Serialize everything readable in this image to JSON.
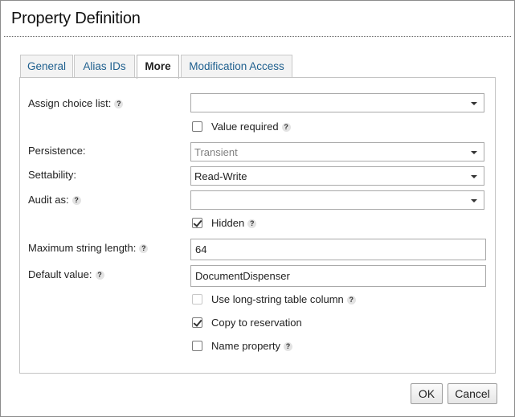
{
  "dialog": {
    "title": "Property Definition"
  },
  "tabs": [
    {
      "label": "General",
      "active": false
    },
    {
      "label": "Alias IDs",
      "active": false
    },
    {
      "label": "More",
      "active": true
    },
    {
      "label": "Modification Access",
      "active": false
    }
  ],
  "form": {
    "assign_choice_list": {
      "label": "Assign choice list:",
      "value": ""
    },
    "value_required": {
      "label": "Value required",
      "checked": false
    },
    "persistence": {
      "label": "Persistence:",
      "value": "Transient",
      "disabled": true
    },
    "settability": {
      "label": "Settability:",
      "value": "Read-Write"
    },
    "audit_as": {
      "label": "Audit as:",
      "value": ""
    },
    "hidden": {
      "label": "Hidden",
      "checked": true
    },
    "max_string_length": {
      "label": "Maximum string length:",
      "value": "64"
    },
    "default_value": {
      "label": "Default value:",
      "value": "DocumentDispenser"
    },
    "long_string": {
      "label": "Use long-string table column",
      "checked": false,
      "disabled": true
    },
    "copy_to_reservation": {
      "label": "Copy to reservation",
      "checked": true
    },
    "name_property": {
      "label": "Name property",
      "checked": false
    }
  },
  "help_glyph": "?",
  "buttons": {
    "ok": "OK",
    "cancel": "Cancel"
  },
  "colors": {
    "tab_link": "#1e5f8e",
    "border": "#a9a9a9",
    "disabled_text": "#808080"
  }
}
